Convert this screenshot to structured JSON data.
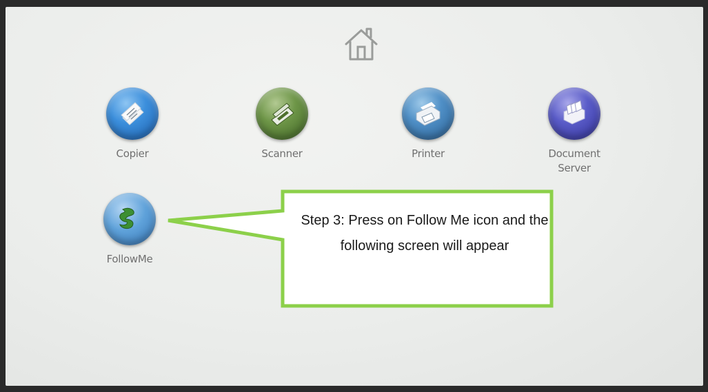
{
  "apps": [
    {
      "id": "copier",
      "label": "Copier",
      "icon": "copier-icon",
      "color": "#2f7fd0"
    },
    {
      "id": "scanner",
      "label": "Scanner",
      "icon": "scanner-icon",
      "color": "#5e8a3a"
    },
    {
      "id": "printer",
      "label": "Printer",
      "icon": "printer-icon",
      "color": "#3f7fb8"
    },
    {
      "id": "document-server",
      "label": "Document\nServer",
      "icon": "document-server-icon",
      "color": "#4a4bb8"
    },
    {
      "id": "followme",
      "label": "FollowMe",
      "icon": "followme-icon",
      "color": "#4a8fcc"
    }
  ],
  "home": {
    "icon": "home-icon"
  },
  "callout": {
    "text": "Step 3: Press on Follow Me icon and the following screen will appear",
    "border_color": "#8cd04a"
  }
}
